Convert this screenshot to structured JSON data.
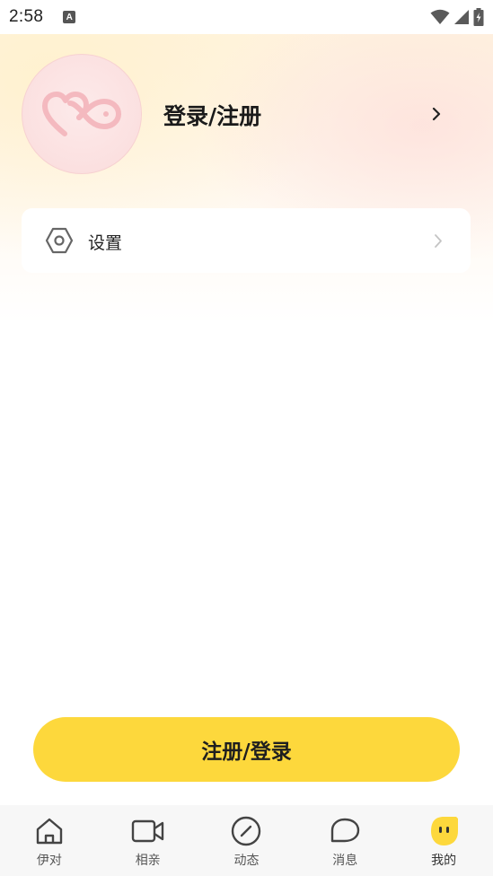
{
  "status_bar": {
    "time": "2:58",
    "notification_badge": "A"
  },
  "profile": {
    "login_text": "登录/注册"
  },
  "menu": {
    "settings_label": "设置"
  },
  "actions": {
    "register_login_label": "注册/登录"
  },
  "bottom_nav": {
    "items": [
      {
        "label": "伊对",
        "icon": "home-icon"
      },
      {
        "label": "相亲",
        "icon": "video-camera-icon"
      },
      {
        "label": "动态",
        "icon": "compass-icon"
      },
      {
        "label": "消息",
        "icon": "message-bubble-icon"
      },
      {
        "label": "我的",
        "icon": "face-avatar-icon",
        "active": true
      }
    ]
  },
  "colors": {
    "accent_yellow": "#fdd83c",
    "avatar_pink": "#f4b9bf",
    "nav_background": "#f7f7f7"
  }
}
